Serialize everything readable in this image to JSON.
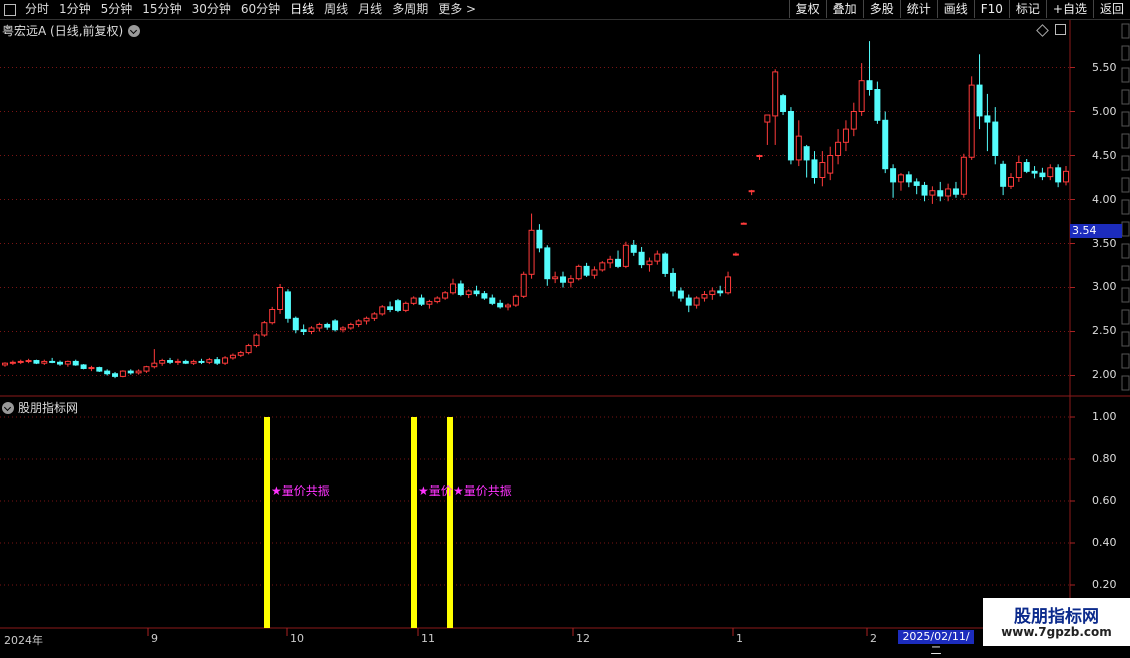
{
  "toolbar": {
    "periods": [
      "分时",
      "1分钟",
      "5分钟",
      "15分钟",
      "30分钟",
      "60分钟",
      "日线",
      "周线",
      "月线",
      "多周期",
      "更多 >"
    ],
    "active_period": "日线",
    "actions": [
      "复权",
      "叠加",
      "多股",
      "统计",
      "画线",
      "F10",
      "标记",
      "+自选",
      "返回"
    ]
  },
  "chart": {
    "title": "粤宏远A (日线,前复权)",
    "price_axis": [
      "5.50",
      "5.00",
      "4.50",
      "4.00",
      "3.50",
      "3.00",
      "2.50",
      "2.00"
    ],
    "current_price": "3.54",
    "up_color": "#ff3b3b",
    "down_color": "#54fcfc"
  },
  "indicator": {
    "title": "股朋指标网",
    "axis": [
      "1.00",
      "0.80",
      "0.60",
      "0.40",
      "0.20"
    ],
    "signal_label": "★量价共振",
    "signal_label_short": "★量价",
    "signal_color": "#ffff00"
  },
  "time_axis": {
    "labels": [
      "2024年",
      "9",
      "10",
      "11",
      "12",
      "1",
      "2"
    ],
    "cursor_date": "2025/02/11/二"
  },
  "watermark": {
    "title": "股朋指标网",
    "url": "www.7gpzb.com"
  },
  "chart_data": {
    "type": "candlestick",
    "ylim": [
      1.7,
      5.85
    ],
    "candles": [
      [
        2.12,
        2.15,
        2.1,
        2.14
      ],
      [
        2.14,
        2.17,
        2.12,
        2.15
      ],
      [
        2.15,
        2.18,
        2.13,
        2.16
      ],
      [
        2.16,
        2.19,
        2.14,
        2.17
      ],
      [
        2.17,
        2.18,
        2.13,
        2.14
      ],
      [
        2.14,
        2.18,
        2.12,
        2.16
      ],
      [
        2.16,
        2.2,
        2.14,
        2.15
      ],
      [
        2.15,
        2.17,
        2.11,
        2.13
      ],
      [
        2.13,
        2.17,
        2.1,
        2.16
      ],
      [
        2.16,
        2.18,
        2.11,
        2.12
      ],
      [
        2.12,
        2.13,
        2.07,
        2.08
      ],
      [
        2.08,
        2.11,
        2.05,
        2.09
      ],
      [
        2.09,
        2.1,
        2.04,
        2.05
      ],
      [
        2.05,
        2.07,
        2.0,
        2.02
      ],
      [
        2.02,
        2.04,
        1.97,
        1.99
      ],
      [
        1.99,
        2.06,
        1.98,
        2.05
      ],
      [
        2.05,
        2.07,
        2.01,
        2.03
      ],
      [
        2.03,
        2.07,
        2.01,
        2.05
      ],
      [
        2.05,
        2.11,
        2.03,
        2.1
      ],
      [
        2.1,
        2.3,
        2.08,
        2.14
      ],
      [
        2.14,
        2.19,
        2.11,
        2.17
      ],
      [
        2.17,
        2.2,
        2.13,
        2.15
      ],
      [
        2.15,
        2.19,
        2.12,
        2.16
      ],
      [
        2.16,
        2.18,
        2.13,
        2.14
      ],
      [
        2.14,
        2.18,
        2.12,
        2.16
      ],
      [
        2.16,
        2.19,
        2.13,
        2.15
      ],
      [
        2.15,
        2.2,
        2.13,
        2.18
      ],
      [
        2.18,
        2.21,
        2.12,
        2.14
      ],
      [
        2.14,
        2.22,
        2.12,
        2.2
      ],
      [
        2.2,
        2.25,
        2.18,
        2.23
      ],
      [
        2.23,
        2.28,
        2.21,
        2.26
      ],
      [
        2.26,
        2.36,
        2.24,
        2.34
      ],
      [
        2.34,
        2.48,
        2.32,
        2.46
      ],
      [
        2.46,
        2.62,
        2.44,
        2.6
      ],
      [
        2.6,
        2.78,
        2.58,
        2.75
      ],
      [
        2.75,
        3.04,
        2.7,
        3.0
      ],
      [
        2.95,
        2.98,
        2.6,
        2.65
      ],
      [
        2.65,
        2.67,
        2.48,
        2.52
      ],
      [
        2.52,
        2.58,
        2.46,
        2.5
      ],
      [
        2.5,
        2.56,
        2.47,
        2.54
      ],
      [
        2.54,
        2.6,
        2.5,
        2.58
      ],
      [
        2.58,
        2.6,
        2.52,
        2.55
      ],
      [
        2.62,
        2.64,
        2.5,
        2.52
      ],
      [
        2.52,
        2.56,
        2.49,
        2.54
      ],
      [
        2.54,
        2.6,
        2.52,
        2.58
      ],
      [
        2.58,
        2.64,
        2.55,
        2.62
      ],
      [
        2.62,
        2.67,
        2.58,
        2.65
      ],
      [
        2.65,
        2.72,
        2.62,
        2.7
      ],
      [
        2.7,
        2.8,
        2.68,
        2.78
      ],
      [
        2.78,
        2.84,
        2.72,
        2.75
      ],
      [
        2.85,
        2.87,
        2.72,
        2.74
      ],
      [
        2.74,
        2.84,
        2.72,
        2.82
      ],
      [
        2.82,
        2.9,
        2.8,
        2.88
      ],
      [
        2.88,
        2.92,
        2.79,
        2.81
      ],
      [
        2.81,
        2.86,
        2.76,
        2.84
      ],
      [
        2.84,
        2.9,
        2.82,
        2.88
      ],
      [
        2.88,
        2.96,
        2.86,
        2.94
      ],
      [
        2.94,
        3.1,
        2.92,
        3.04
      ],
      [
        3.04,
        3.08,
        2.9,
        2.92
      ],
      [
        2.92,
        2.98,
        2.88,
        2.96
      ],
      [
        2.96,
        3.02,
        2.9,
        2.93
      ],
      [
        2.93,
        2.96,
        2.86,
        2.88
      ],
      [
        2.88,
        2.92,
        2.8,
        2.82
      ],
      [
        2.82,
        2.86,
        2.76,
        2.78
      ],
      [
        2.78,
        2.82,
        2.74,
        2.8
      ],
      [
        2.8,
        2.92,
        2.78,
        2.9
      ],
      [
        2.9,
        3.18,
        2.88,
        3.15
      ],
      [
        3.15,
        3.84,
        3.1,
        3.65
      ],
      [
        3.65,
        3.72,
        3.4,
        3.45
      ],
      [
        3.45,
        3.48,
        3.02,
        3.1
      ],
      [
        3.1,
        3.18,
        3.05,
        3.12
      ],
      [
        3.12,
        3.18,
        3.0,
        3.06
      ],
      [
        3.06,
        3.14,
        3.0,
        3.1
      ],
      [
        3.1,
        3.26,
        3.08,
        3.24
      ],
      [
        3.24,
        3.28,
        3.12,
        3.14
      ],
      [
        3.14,
        3.24,
        3.1,
        3.2
      ],
      [
        3.2,
        3.3,
        3.18,
        3.28
      ],
      [
        3.28,
        3.36,
        3.22,
        3.32
      ],
      [
        3.32,
        3.42,
        3.22,
        3.24
      ],
      [
        3.24,
        3.52,
        3.22,
        3.48
      ],
      [
        3.48,
        3.54,
        3.36,
        3.4
      ],
      [
        3.4,
        3.46,
        3.22,
        3.26
      ],
      [
        3.26,
        3.34,
        3.18,
        3.3
      ],
      [
        3.3,
        3.42,
        3.26,
        3.38
      ],
      [
        3.38,
        3.4,
        3.12,
        3.16
      ],
      [
        3.16,
        3.22,
        2.9,
        2.96
      ],
      [
        2.96,
        3.0,
        2.84,
        2.88
      ],
      [
        2.88,
        2.92,
        2.72,
        2.8
      ],
      [
        2.8,
        2.9,
        2.76,
        2.88
      ],
      [
        2.88,
        2.96,
        2.84,
        2.92
      ],
      [
        2.92,
        3.0,
        2.86,
        2.96
      ],
      [
        2.96,
        3.02,
        2.9,
        2.94
      ],
      [
        2.94,
        3.18,
        2.92,
        3.12
      ],
      [
        3.38,
        3.4,
        3.36,
        3.38
      ],
      [
        3.73,
        3.74,
        3.72,
        3.73
      ],
      [
        4.1,
        4.11,
        4.05,
        4.1
      ],
      [
        4.5,
        4.51,
        4.45,
        4.5
      ],
      [
        4.88,
        4.95,
        4.62,
        4.96
      ],
      [
        4.95,
        5.48,
        4.62,
        5.45
      ],
      [
        5.18,
        5.2,
        4.96,
        5.0
      ],
      [
        5.0,
        5.05,
        4.4,
        4.45
      ],
      [
        4.45,
        4.9,
        4.38,
        4.72
      ],
      [
        4.6,
        4.62,
        4.25,
        4.45
      ],
      [
        4.45,
        4.55,
        4.18,
        4.25
      ],
      [
        4.25,
        4.55,
        4.15,
        4.42
      ],
      [
        4.3,
        4.6,
        4.22,
        4.5
      ],
      [
        4.5,
        4.8,
        4.4,
        4.65
      ],
      [
        4.65,
        4.9,
        4.55,
        4.8
      ],
      [
        4.8,
        5.1,
        4.72,
        5.0
      ],
      [
        5.0,
        5.55,
        4.95,
        5.35
      ],
      [
        5.35,
        5.8,
        5.18,
        5.25
      ],
      [
        5.25,
        5.34,
        4.86,
        4.9
      ],
      [
        4.9,
        5.0,
        4.3,
        4.35
      ],
      [
        4.35,
        4.4,
        4.02,
        4.2
      ],
      [
        4.2,
        4.3,
        4.1,
        4.28
      ],
      [
        4.28,
        4.32,
        4.14,
        4.2
      ],
      [
        4.2,
        4.24,
        4.06,
        4.16
      ],
      [
        4.16,
        4.2,
        3.98,
        4.05
      ],
      [
        4.05,
        4.15,
        3.95,
        4.1
      ],
      [
        4.1,
        4.2,
        3.98,
        4.04
      ],
      [
        4.04,
        4.18,
        3.98,
        4.12
      ],
      [
        4.12,
        4.2,
        4.02,
        4.06
      ],
      [
        4.06,
        4.52,
        4.02,
        4.48
      ],
      [
        4.48,
        5.4,
        4.45,
        5.3
      ],
      [
        5.3,
        5.65,
        4.8,
        4.95
      ],
      [
        4.95,
        5.2,
        4.55,
        4.88
      ],
      [
        4.88,
        5.05,
        4.4,
        4.5
      ],
      [
        4.4,
        4.44,
        4.05,
        4.15
      ],
      [
        4.15,
        4.3,
        4.12,
        4.25
      ],
      [
        4.25,
        4.5,
        4.2,
        4.42
      ],
      [
        4.42,
        4.46,
        4.3,
        4.32
      ],
      [
        4.32,
        4.38,
        4.24,
        4.3
      ],
      [
        4.3,
        4.36,
        4.22,
        4.26
      ],
      [
        4.26,
        4.4,
        4.22,
        4.36
      ],
      [
        4.36,
        4.4,
        4.14,
        4.2
      ],
      [
        4.2,
        4.38,
        4.16,
        4.32
      ]
    ],
    "signals": [
      {
        "label": "★量价共振",
        "value": 1.0
      },
      {
        "label": "★量价",
        "value": 1.0
      },
      {
        "label": "★量价共振",
        "value": 1.0
      }
    ]
  }
}
